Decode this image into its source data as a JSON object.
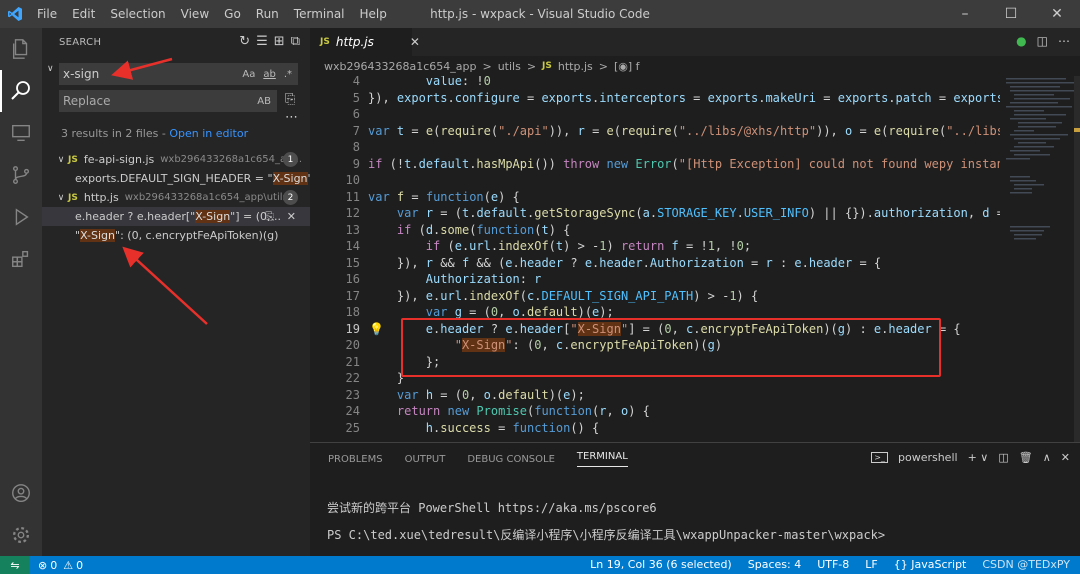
{
  "titlebar": {
    "menu": [
      "File",
      "Edit",
      "Selection",
      "View",
      "Go",
      "Run",
      "Terminal",
      "Help"
    ],
    "title": "http.js - wxpack - Visual Studio Code"
  },
  "search": {
    "header": "SEARCH",
    "query": "x-sign",
    "replace_placeholder": "Replace",
    "opt_case": "Aa",
    "opt_word": "ab",
    "opt_regex": ".*",
    "opt_preserve": "AB",
    "results_summary": "3 results in 2 files - ",
    "open_in_editor": "Open in editor",
    "files": [
      {
        "name": "fe-api-sign.js",
        "path": "wxb296433268a1c654_ap...",
        "count": "1",
        "matches": [
          {
            "pre": "exports.DEFAULT_SIGN_HEADER = \"",
            "hit": "X-Sign",
            "post": "\";"
          }
        ]
      },
      {
        "name": "http.js",
        "path": "wxb296433268a1c654_app\\utils",
        "count": "2",
        "matches": [
          {
            "pre": "e.header ? e.header[\"",
            "hit": "X-Sign",
            "post": "\"] = (0,..."
          },
          {
            "pre": "\"",
            "hit": "X-Sign",
            "post": "\": (0, c.encryptFeApiToken)(g)"
          }
        ]
      }
    ]
  },
  "editor": {
    "tab": "http.js",
    "breadcrumbs": [
      "wxb296433268a1c654_app",
      ">",
      "utils",
      ">",
      "JS",
      "http.js",
      ">",
      "[◉] f"
    ],
    "line_numbers": [
      "4",
      "5",
      "6",
      "7",
      "8",
      "9",
      "10",
      "11",
      "12",
      "13",
      "14",
      "15",
      "16",
      "17",
      "18",
      "19",
      "20",
      "21",
      "22",
      "23",
      "24",
      "25"
    ],
    "current_line": "19"
  },
  "terminal": {
    "tabs": [
      "PROBLEMS",
      "OUTPUT",
      "DEBUG CONSOLE",
      "TERMINAL"
    ],
    "shell": "powershell",
    "line1": "尝试新的跨平台 PowerShell https://aka.ms/pscore6",
    "line2": "PS C:\\ted.xue\\tedresult\\反编译小程序\\小程序反编译工具\\wxappUnpacker-master\\wxpack>"
  },
  "status": {
    "errors": "0",
    "warnings": "0",
    "position": "Ln 19, Col 36 (6 selected)",
    "spaces": "Spaces: 4",
    "encoding": "UTF-8",
    "eol": "LF",
    "language": "JavaScript",
    "watermark": "CSDN @TEDxPY"
  },
  "colors": {
    "accent": "#007acc",
    "highlight_box": "#e8302b",
    "arrow": "#e8302b"
  }
}
